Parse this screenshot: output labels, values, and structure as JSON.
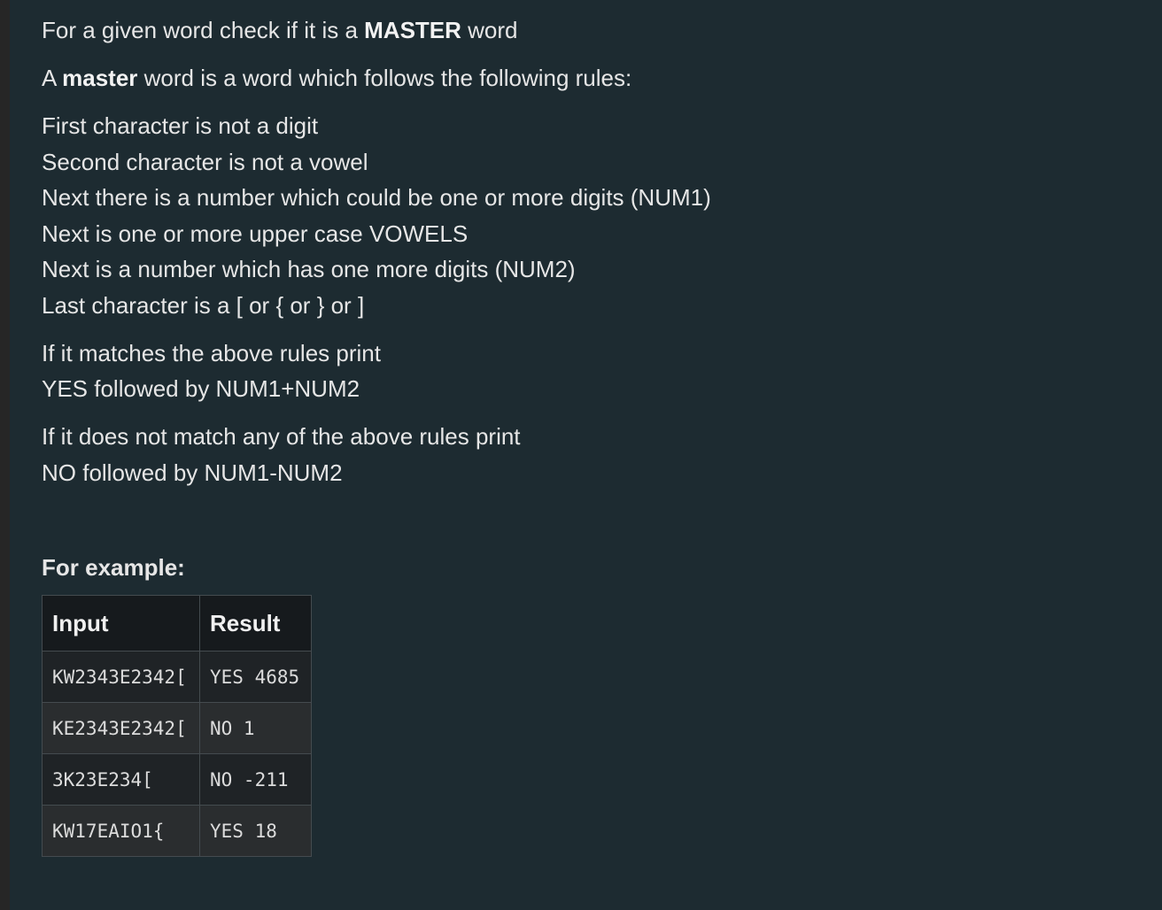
{
  "intro": {
    "prefix": "For a given word check if it is a ",
    "emphasis": "MASTER",
    "suffix": " word"
  },
  "definition": {
    "prefix": "A ",
    "emphasis": "master",
    "suffix": " word is a word which follows the following rules:"
  },
  "rules": [
    "First character is not a digit",
    "Second character is not a vowel",
    "Next there is a number which could be one or more digits (NUM1)",
    "Next is one or more upper case VOWELS",
    "Next is a number which has one more digits (NUM2)",
    "Last character is a [ or { or } or ]"
  ],
  "match_block": [
    "If it matches the above rules print",
    "YES followed by NUM1+NUM2"
  ],
  "nomatch_block": [
    "If it does not match any of the above rules print",
    "NO followed by NUM1-NUM2"
  ],
  "example_heading": "For example:",
  "table": {
    "headers": [
      "Input",
      "Result"
    ],
    "rows": [
      [
        "KW2343E2342[",
        "YES 4685"
      ],
      [
        "KE2343E2342[",
        "NO 1"
      ],
      [
        "3K23E234[",
        "NO -211"
      ],
      [
        "KW17EAIO1{",
        "YES 18"
      ]
    ]
  },
  "colors": {
    "background": "#1d2b31",
    "text": "#e6e6e6",
    "table_header_bg": "#161a1d",
    "table_row_dark": "#1f2326",
    "table_row_light": "#2a2d2f",
    "table_border": "#444b4f"
  }
}
